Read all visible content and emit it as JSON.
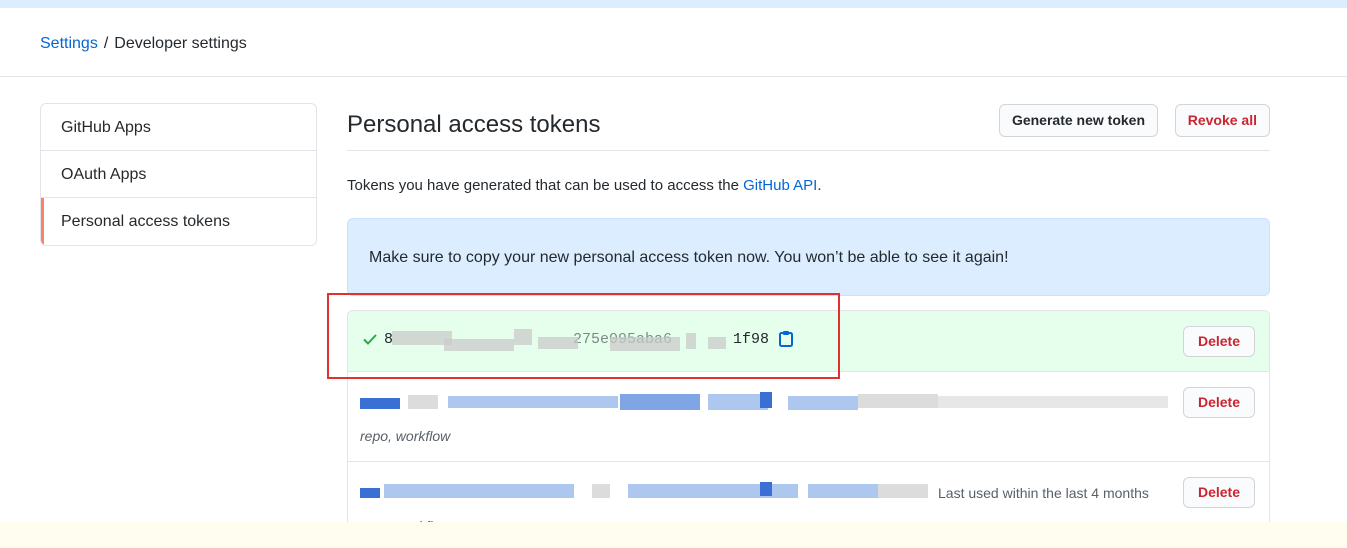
{
  "breadcrumb": {
    "root": "Settings",
    "separator": "/",
    "current": "Developer settings"
  },
  "sidebar": {
    "items": [
      {
        "label": "GitHub Apps",
        "selected": false
      },
      {
        "label": "OAuth Apps",
        "selected": false
      },
      {
        "label": "Personal access tokens",
        "selected": true
      }
    ]
  },
  "main": {
    "title": "Personal access tokens",
    "generate_label": "Generate new token",
    "revoke_label": "Revoke all",
    "description_prefix": "Tokens you have generated that can be used to access the ",
    "description_link": "GitHub API",
    "description_suffix": ".",
    "flash_message": "Make sure to copy your new personal access token now. You won’t be able to see it again!"
  },
  "tokens": {
    "new_token": {
      "visible_fragment_start": "8",
      "visible_fragment_mid": "275e095aba6",
      "visible_fragment_end": "1f98",
      "delete_label": "Delete"
    },
    "rows": [
      {
        "scopes": "repo, workflow",
        "last_used": "",
        "delete_label": "Delete"
      },
      {
        "scopes": "repo, workflow",
        "last_used": "Last used within the last 4 months",
        "delete_label": "Delete"
      }
    ]
  },
  "colors": {
    "link": "#0366d6",
    "danger": "#cb2431",
    "success_bg": "#e6ffed",
    "flash_bg": "#dbedff",
    "selected_accent": "#f9826c",
    "annotation_red": "#e03131"
  },
  "icons": {
    "check": "check-icon",
    "copy": "clipboard-icon"
  }
}
